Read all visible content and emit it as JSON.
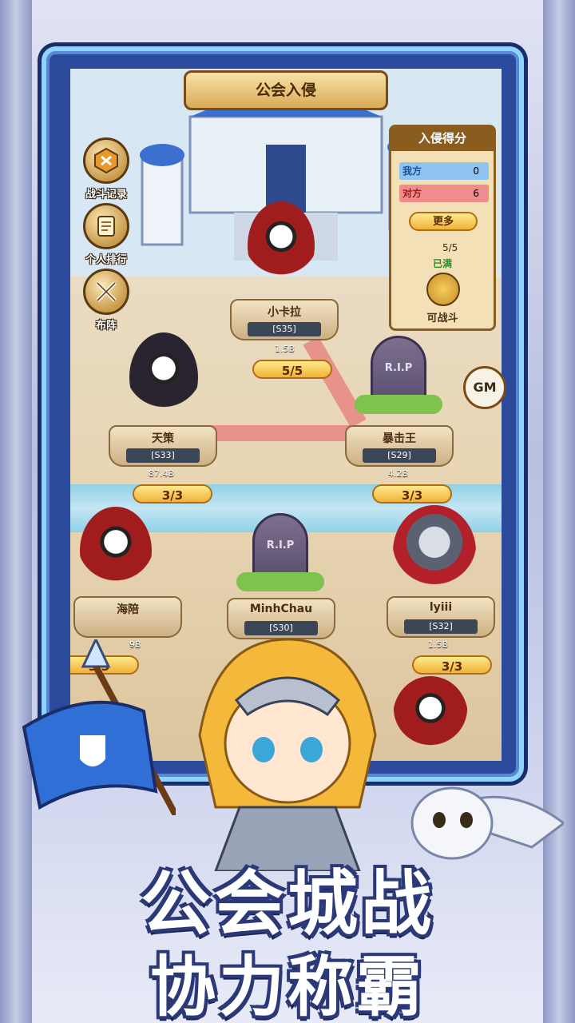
{
  "title": "公会入侵",
  "side_menu": [
    {
      "label": "战斗记录",
      "icon": "battle-record-icon"
    },
    {
      "label": "个人排行",
      "icon": "ranking-scroll-icon"
    },
    {
      "label": "布阵",
      "icon": "formation-swords-icon"
    }
  ],
  "score_panel": {
    "header": "入侵得分",
    "rows": [
      {
        "side": "我方",
        "score": "0",
        "color": "#8fc3f0"
      },
      {
        "side": "对方",
        "score": "6",
        "color": "#f08c8c"
      }
    ],
    "more_label": "更多",
    "attempts": "5/5",
    "status": "已满",
    "fight_label": "可战斗"
  },
  "gm_label": "GM",
  "nodes": [
    {
      "name": "小卡拉",
      "server": "[S35]",
      "power": "1.5B",
      "count": "5/5",
      "state": "alive"
    },
    {
      "name": "天策",
      "server": "[S33]",
      "power": "87.4B",
      "count": "3/3",
      "state": "alive"
    },
    {
      "name": "暴击王",
      "server": "[S29]",
      "power": "4.2B",
      "count": "3/3",
      "state": "defeated"
    },
    {
      "name": "海陪",
      "server": "",
      "power": "9B",
      "count": "3/3",
      "state": "alive"
    },
    {
      "name": "MinhChau",
      "server": "[S30]",
      "power": "",
      "count": "",
      "state": "defeated"
    },
    {
      "name": "lyiii",
      "server": "[S32]",
      "power": "1.5B",
      "count": "3/3",
      "state": "alive"
    }
  ],
  "tomb_text": "R.I.P",
  "headline": "公会城战",
  "subheadline": "协力称霸",
  "colors": {
    "frame": "#2c4a9c",
    "gold": "#f0b23a",
    "headline_stroke": "#2b3978"
  }
}
